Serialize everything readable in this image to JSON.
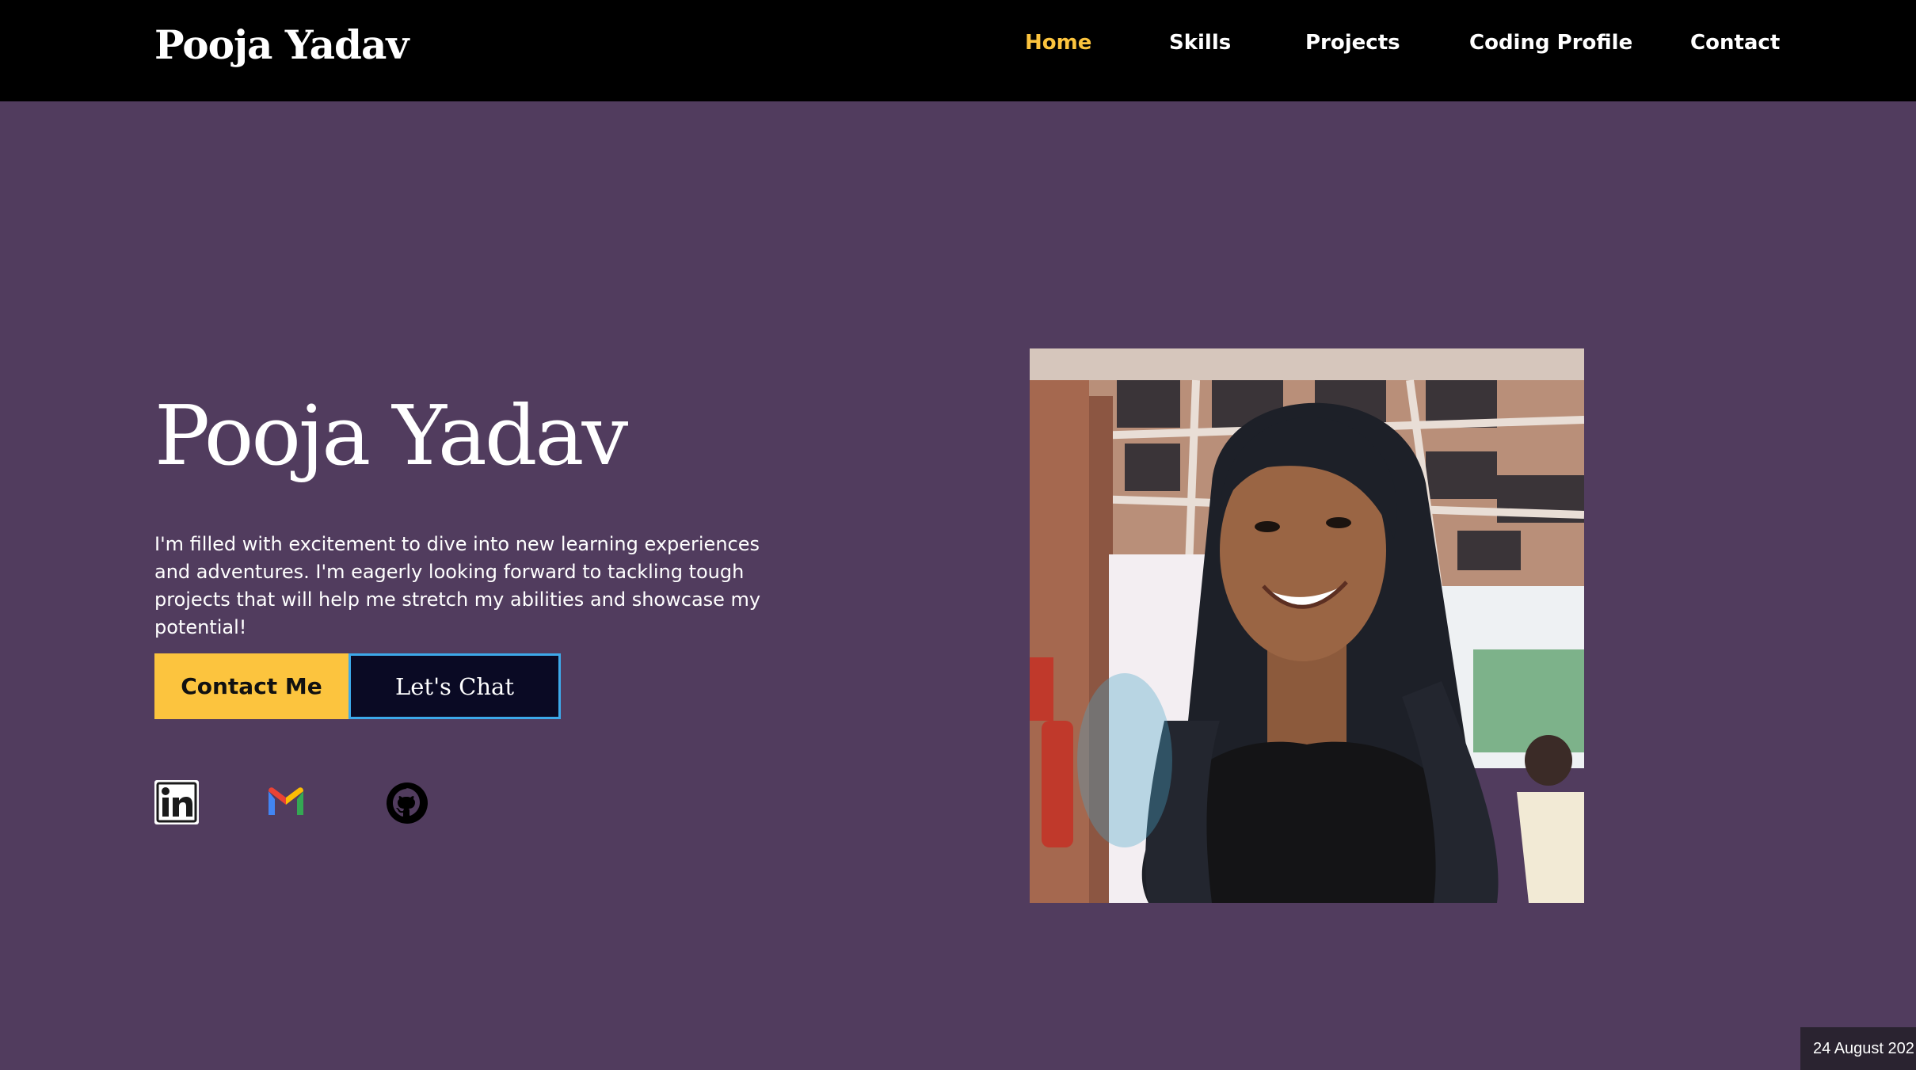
{
  "brand": "Pooja Yadav",
  "nav": {
    "home": "Home",
    "skills": "Skills",
    "projects": "Projects",
    "coding_profile": "Coding Profile",
    "contact": "Contact",
    "active": "Home"
  },
  "hero": {
    "name": "Pooja Yadav",
    "description": "I'm filled with excitement to dive into new learning experiences and adventures. I'm eagerly looking forward to tackling tough projects that will help me stretch my abilities and showcase my potential!",
    "contact_button": "Contact Me",
    "chat_button": "Let's Chat"
  },
  "social_links": [
    "linkedin-icon",
    "gmail-icon",
    "github-icon"
  ],
  "date_overlay": "24 August 202",
  "colors": {
    "background": "#513c5e",
    "navbar": "#000000",
    "accent": "#fcc43e",
    "chat_button_bg": "#0a0a24",
    "chat_button_border": "#3da9ea"
  }
}
